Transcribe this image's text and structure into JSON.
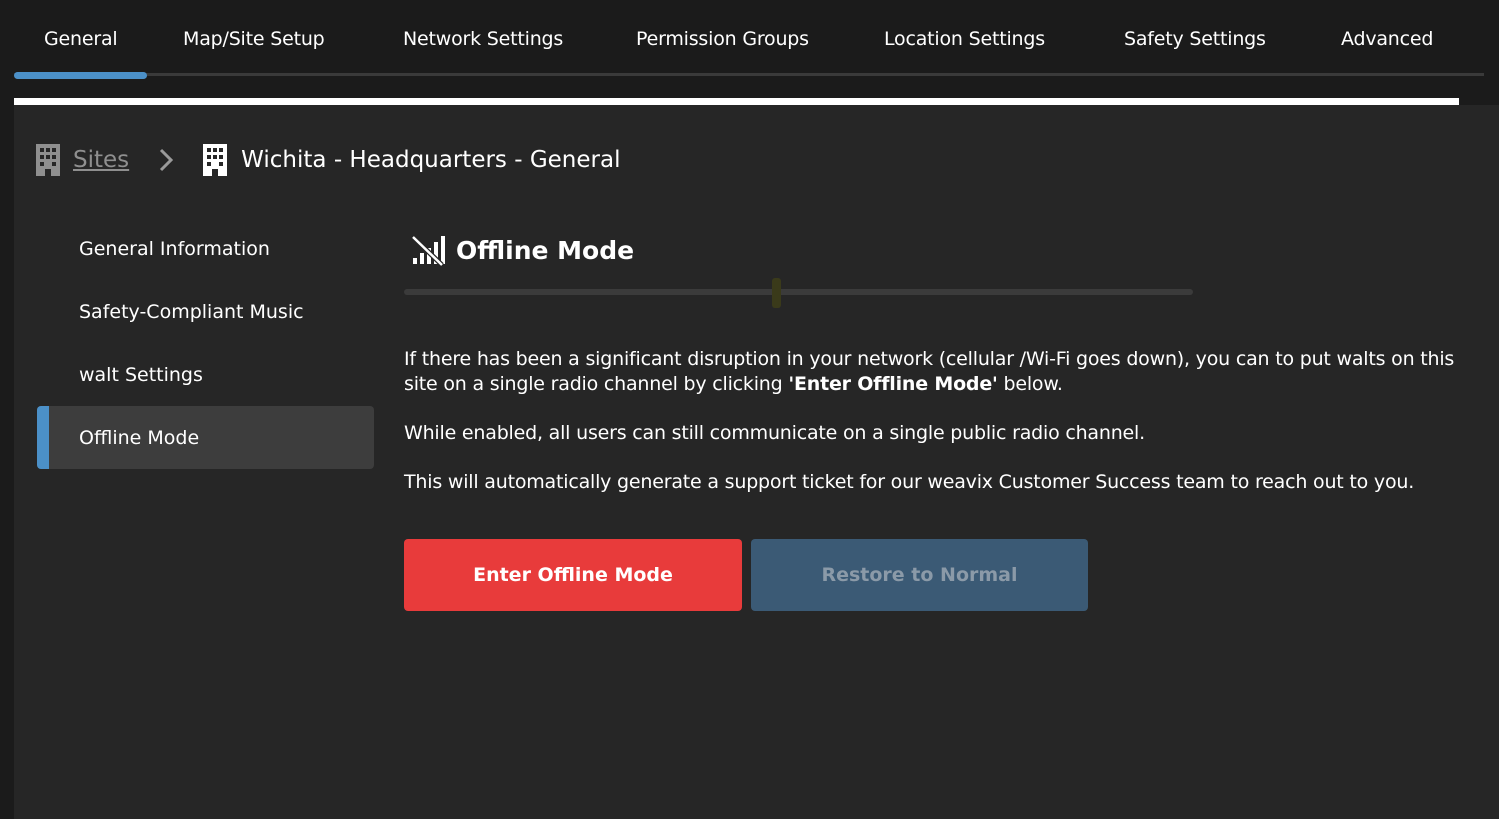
{
  "tabs": [
    {
      "label": "General",
      "active": true
    },
    {
      "label": "Map/Site Setup",
      "active": false
    },
    {
      "label": "Network Settings",
      "active": false
    },
    {
      "label": "Permission Groups",
      "active": false
    },
    {
      "label": "Location Settings",
      "active": false
    },
    {
      "label": "Safety Settings",
      "active": false
    },
    {
      "label": "Advanced",
      "active": false
    }
  ],
  "breadcrumb": {
    "root_icon": "building-icon",
    "root_label": "Sites",
    "separator_icon": "chevron-right-icon",
    "current_icon": "building-icon",
    "current_label": "Wichita - Headquarters - General"
  },
  "sidemenu": {
    "items": [
      {
        "label": "General Information",
        "active": false
      },
      {
        "label": "Safety-Compliant Music",
        "active": false
      },
      {
        "label": "walt Settings",
        "active": false
      },
      {
        "label": "Offline Mode",
        "active": true
      }
    ]
  },
  "main": {
    "icon": "signal-off-icon",
    "title": "Offline Mode",
    "paragraph1_prefix": "If there has been a significant disruption in your network (cellular /Wi-Fi goes down), you can to put walts on this site on a single radio channel by clicking ",
    "paragraph1_bold": "'Enter Offline Mode'",
    "paragraph1_suffix": " below.",
    "paragraph2": "While enabled, all users can still communicate on a single public radio channel.",
    "paragraph3": "This will automatically generate a support ticket for our weavix Customer Success team to reach out to you.",
    "enter_button": "Enter Offline Mode",
    "restore_button": "Restore to Normal"
  },
  "colors": {
    "accent": "#4b90c8",
    "danger": "#e83b3b",
    "disabled_button": "#3b5a75",
    "panel_bg": "#262626",
    "page_bg": "#1b1b1b"
  }
}
